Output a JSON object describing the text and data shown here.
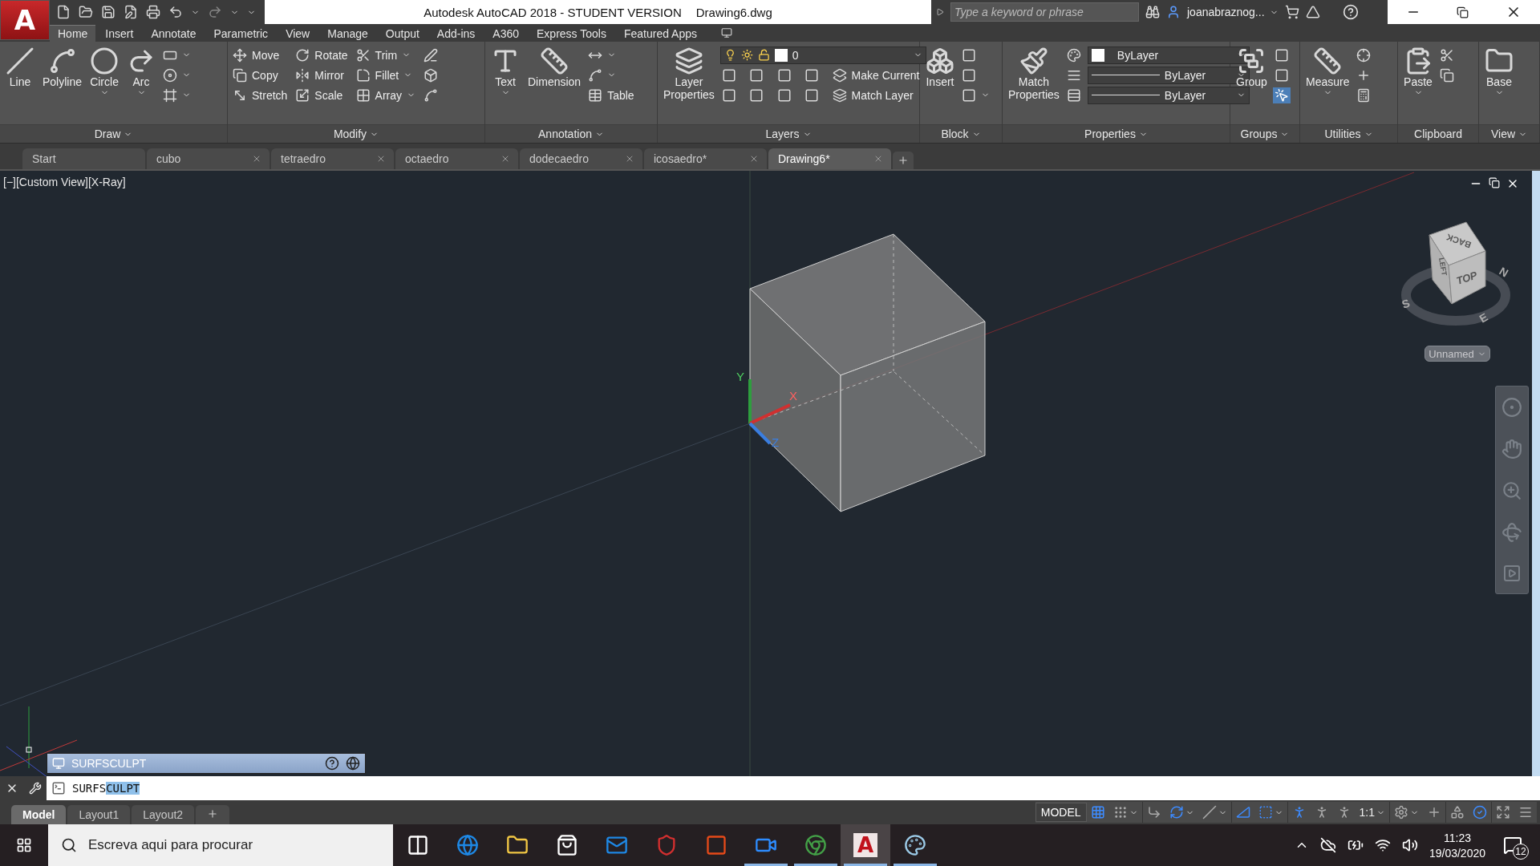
{
  "logo": "A",
  "title_bar": {
    "title": "Autodesk AutoCAD 2018 - STUDENT VERSION",
    "document": "Drawing6.dwg",
    "search": {
      "placeholder": "Type a keyword or phrase"
    },
    "user": "joanabraznog..."
  },
  "ribbon_tabs": [
    {
      "label": "Home",
      "selected": true
    },
    {
      "label": "Insert",
      "selected": false
    },
    {
      "label": "Annotate",
      "selected": false
    },
    {
      "label": "Parametric",
      "selected": false
    },
    {
      "label": "View",
      "selected": false
    },
    {
      "label": "Manage",
      "selected": false
    },
    {
      "label": "Output",
      "selected": false
    },
    {
      "label": "Add-ins",
      "selected": false
    },
    {
      "label": "A360",
      "selected": false
    },
    {
      "label": "Express Tools",
      "selected": false
    },
    {
      "label": "Featured Apps",
      "selected": false
    }
  ],
  "ribbon_panels": [
    {
      "title": "Draw",
      "menu": true,
      "large": [
        {
          "label": "Line",
          "menu": false
        },
        {
          "label": "Polyline",
          "menu": false
        },
        {
          "label": "Circle",
          "menu": true
        },
        {
          "label": "Arc",
          "menu": true
        }
      ],
      "rows": [
        [
          {
            "kind": "icon",
            "menu": true
          }
        ],
        [
          {
            "kind": "icon",
            "menu": true
          }
        ],
        [
          {
            "kind": "icon",
            "menu": true
          }
        ]
      ]
    },
    {
      "title": "Modify",
      "menu": true,
      "rows": [
        [
          {
            "kind": "text",
            "label": "Move",
            "menu": false
          },
          {
            "kind": "text",
            "label": "Rotate",
            "menu": false
          },
          {
            "kind": "text",
            "label": "Trim",
            "menu": true
          },
          {
            "kind": "icon",
            "menu": false
          }
        ],
        [
          {
            "kind": "text",
            "label": "Copy",
            "menu": false
          },
          {
            "kind": "text",
            "label": "Mirror",
            "menu": false
          },
          {
            "kind": "text",
            "label": "Fillet",
            "menu": true
          },
          {
            "kind": "icon",
            "menu": false
          }
        ],
        [
          {
            "kind": "text",
            "label": "Stretch",
            "menu": false
          },
          {
            "kind": "text",
            "label": "Scale",
            "menu": false
          },
          {
            "kind": "text",
            "label": "Array",
            "menu": true
          },
          {
            "kind": "icon",
            "menu": false
          }
        ]
      ]
    },
    {
      "title": "Annotation",
      "menu": true,
      "large": [
        {
          "label": "Text",
          "menu": true
        },
        {
          "label": "Dimension",
          "menu": false
        }
      ],
      "rows": [
        [
          {
            "kind": "icon",
            "menu": true
          }
        ],
        [
          {
            "kind": "icon",
            "menu": true
          }
        ],
        [
          {
            "kind": "text",
            "label": "Table",
            "menu": false
          }
        ]
      ]
    },
    {
      "title": "Layers",
      "menu": true,
      "large": [
        {
          "label": "Layer Properties",
          "menu": false
        }
      ],
      "rows": [
        [
          {
            "kind": "layer_dropdown",
            "label": "0"
          }
        ],
        [
          {
            "kind": "icon",
            "menu": false
          },
          {
            "kind": "icon",
            "menu": false
          },
          {
            "kind": "icon",
            "menu": false
          },
          {
            "kind": "icon",
            "menu": false
          },
          {
            "kind": "text",
            "label": "Make Current",
            "menu": false
          }
        ],
        [
          {
            "kind": "icon",
            "menu": false
          },
          {
            "kind": "icon",
            "menu": false
          },
          {
            "kind": "icon",
            "menu": false
          },
          {
            "kind": "icon",
            "menu": false
          },
          {
            "kind": "text",
            "label": "Match Layer",
            "menu": false
          }
        ]
      ]
    },
    {
      "title": "Block",
      "menu": true,
      "large": [
        {
          "label": "Insert",
          "menu": false
        }
      ],
      "rows": [
        [
          {
            "kind": "icon",
            "menu": false
          }
        ],
        [
          {
            "kind": "icon",
            "menu": false
          }
        ],
        [
          {
            "kind": "icon",
            "menu": true
          }
        ]
      ]
    },
    {
      "title": "Properties",
      "menu": true,
      "large": [
        {
          "label": "Match Properties",
          "menu": false
        }
      ],
      "rows": [
        [
          {
            "kind": "icon",
            "menu": false
          },
          {
            "kind": "color_dropdown",
            "label": "ByLayer"
          }
        ],
        [
          {
            "kind": "icon",
            "menu": false
          },
          {
            "kind": "line_dropdown",
            "label": "ByLayer"
          }
        ],
        [
          {
            "kind": "icon",
            "menu": false
          },
          {
            "kind": "line_dropdown",
            "label": "ByLayer"
          }
        ]
      ]
    },
    {
      "title": "Groups",
      "menu": true,
      "large": [
        {
          "label": "Group",
          "menu": false
        }
      ],
      "rows": [
        [
          {
            "kind": "icon",
            "menu": false
          }
        ],
        [
          {
            "kind": "icon",
            "menu": false
          }
        ],
        [
          {
            "kind": "active_icon",
            "menu": false
          }
        ]
      ]
    },
    {
      "title": "Utilities",
      "menu": true,
      "large": [
        {
          "label": "Measure",
          "menu": true
        }
      ],
      "rows": [
        [
          {
            "kind": "icon",
            "menu": false
          }
        ],
        [
          {
            "kind": "icon",
            "menu": false
          }
        ],
        [
          {
            "kind": "icon",
            "menu": false
          }
        ]
      ]
    },
    {
      "title": "Clipboard",
      "menu": false,
      "large": [
        {
          "label": "Paste",
          "menu": true
        }
      ],
      "rows": [
        [
          {
            "kind": "icon",
            "menu": false
          }
        ],
        [
          {
            "kind": "icon",
            "menu": false
          }
        ]
      ]
    },
    {
      "title": "View",
      "menu": true,
      "large": [
        {
          "label": "Base",
          "menu": true
        }
      ]
    }
  ],
  "file_tabs": [
    {
      "label": "Start",
      "selected": false,
      "closable": false
    },
    {
      "label": "cubo",
      "selected": false,
      "closable": true
    },
    {
      "label": "tetraedro",
      "selected": false,
      "closable": true
    },
    {
      "label": "octaedro",
      "selected": false,
      "closable": true
    },
    {
      "label": "dodecaedro",
      "selected": false,
      "closable": true
    },
    {
      "label": "icosaedro*",
      "selected": false,
      "closable": true
    },
    {
      "label": "Drawing6*",
      "selected": true,
      "closable": true
    }
  ],
  "viewport": {
    "label": "[−][Custom View][X-Ray]",
    "ucs": {
      "x": "X",
      "y": "Y",
      "z": "Z"
    },
    "viewcube": {
      "faces": [
        "BACK",
        "TOP",
        "LEFT"
      ],
      "compass": [
        "N",
        "S",
        "E"
      ],
      "view": "Unnamed"
    }
  },
  "command_suggestion": "SURFSCULPT",
  "command_line": {
    "typed": "SURFS",
    "completion": "CULPT"
  },
  "layout_tabs": [
    {
      "label": "Model",
      "selected": true
    },
    {
      "label": "Layout1",
      "selected": false
    },
    {
      "label": "Layout2",
      "selected": false
    }
  ],
  "status_items": [
    {
      "kind": "text",
      "label": "MODEL"
    },
    {
      "kind": "toggle",
      "on": true,
      "menu": false
    },
    {
      "kind": "toggle",
      "on": false,
      "menu": true
    },
    {
      "kind": "separator"
    },
    {
      "kind": "toggle",
      "on": false,
      "menu": false
    },
    {
      "kind": "toggle",
      "on": true,
      "menu": true
    },
    {
      "kind": "toggle",
      "on": false,
      "menu": true
    },
    {
      "kind": "separator"
    },
    {
      "kind": "toggle",
      "on": true,
      "menu": false
    },
    {
      "kind": "toggle",
      "on": true,
      "menu": true
    },
    {
      "kind": "separator"
    },
    {
      "kind": "toggle",
      "on": true,
      "menu": false
    },
    {
      "kind": "toggle",
      "on": false,
      "menu": false
    },
    {
      "kind": "toggle",
      "on": false,
      "menu": false
    },
    {
      "kind": "scale",
      "label": "1:1"
    },
    {
      "kind": "separator"
    },
    {
      "kind": "toggle",
      "on": false,
      "menu": true
    },
    {
      "kind": "toggle",
      "on": false,
      "menu": false
    },
    {
      "kind": "separator"
    },
    {
      "kind": "toggle",
      "on": false,
      "menu": false
    },
    {
      "kind": "toggle",
      "on": true,
      "menu": false
    },
    {
      "kind": "separator"
    },
    {
      "kind": "toggle",
      "on": false,
      "menu": false
    },
    {
      "kind": "toggle",
      "on": false,
      "menu": false
    }
  ],
  "taskbar": {
    "search": {
      "placeholder": "Escreva aqui para procurar"
    },
    "apps": [
      {
        "running": false,
        "selected": false
      },
      {
        "running": false,
        "selected": false
      },
      {
        "running": false,
        "selected": false
      },
      {
        "running": false,
        "selected": false
      },
      {
        "running": false,
        "selected": false
      },
      {
        "running": false,
        "selected": false
      },
      {
        "running": false,
        "selected": false
      },
      {
        "running": true,
        "selected": false
      },
      {
        "running": true,
        "selected": false
      },
      {
        "running": true,
        "selected": true,
        "label": "A"
      },
      {
        "running": true,
        "selected": false
      }
    ],
    "time": "11:23",
    "date": "19/03/2020",
    "notifications": "12"
  }
}
